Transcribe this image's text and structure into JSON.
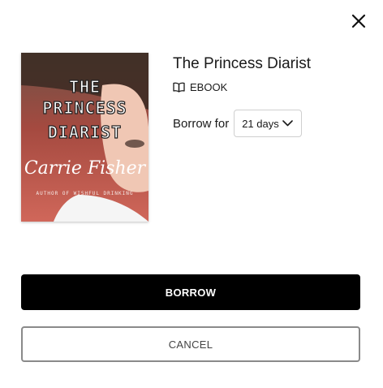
{
  "dialog": {
    "close_icon": "close-icon",
    "book": {
      "title": "The Princess Diarist",
      "format_icon": "open-book-icon",
      "format": "EBOOK",
      "cover": {
        "title_line1": "THE",
        "title_line2": "PRINCESS",
        "title_line3": "DIARIST",
        "author": "Carrie Fisher",
        "subtitle": "AUTHOR OF WISHFUL DRINKING",
        "colors": {
          "background": "#c0564d",
          "skin": "#f0c7b4",
          "hair": "#3a2a22"
        }
      }
    },
    "borrow_label": "Borrow for",
    "borrow_period": "21 days",
    "borrow_button": "BORROW",
    "cancel_button": "CANCEL"
  },
  "colors": {
    "primary_button_bg": "#000000",
    "secondary_button_border": "#8a8a8a"
  }
}
